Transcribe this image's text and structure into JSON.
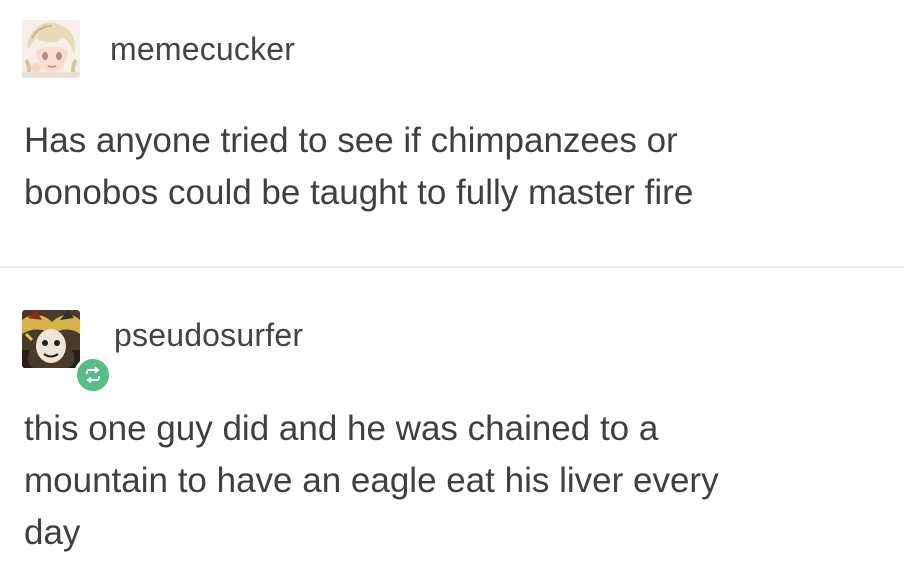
{
  "posts": [
    {
      "username": "memecucker",
      "avatar_icon": "anime-girl-avatar-icon",
      "text_lines": [
        "Has anyone tried to see if chimpanzees or",
        "bonobos could be taught to fully master fire"
      ]
    },
    {
      "username": "pseudosurfer",
      "avatar_icon": "jester-avatar-icon",
      "reblog_icon": "reblog-icon",
      "reblog_color": "#56bc8a",
      "text_lines": [
        "this one guy did and he was chained to a",
        "mountain to have an eagle eat his liver every",
        "day"
      ]
    }
  ]
}
